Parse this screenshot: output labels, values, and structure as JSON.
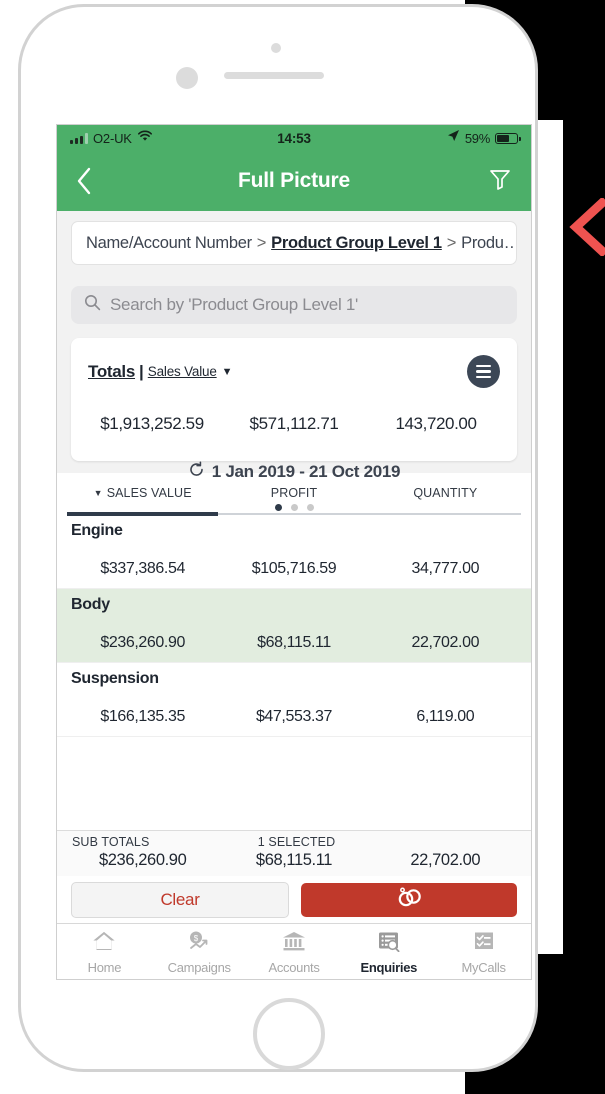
{
  "status_bar": {
    "carrier": "O2-UK",
    "time": "14:53",
    "battery_percent": "59%",
    "wifi_icon": "wifi-icon",
    "location_icon": "location-arrow-icon",
    "battery_icon": "battery-icon"
  },
  "nav": {
    "title": "Full Picture",
    "back_icon": "back-chevron-icon",
    "filter_icon": "filter-funnel-icon"
  },
  "breadcrumb": {
    "item1": "Name/Account Number",
    "sep1": ">",
    "item2": "Product Group Level 1",
    "sep2": ">",
    "item3": "Produ…"
  },
  "date_range": {
    "refresh_icon": "refresh-icon",
    "label": "1 Jan 2019 - 21 Oct 2019"
  },
  "search": {
    "placeholder": "Search by 'Product Group Level 1'",
    "icon": "search-icon"
  },
  "totals": {
    "label": "Totals",
    "pipe": "|",
    "metric": "Sales Value",
    "caret": "▼",
    "menu_icon": "hamburger-menu-icon",
    "values": [
      "$1,913,252.59",
      "$571,112.71",
      "143,720.00"
    ]
  },
  "table": {
    "columns": [
      {
        "label": "SALES VALUE",
        "sorted": true,
        "sort_caret": "▼"
      },
      {
        "label": "PROFIT",
        "sorted": false,
        "sort_caret": ""
      },
      {
        "label": "QUANTITY",
        "sorted": false,
        "sort_caret": ""
      }
    ],
    "page_dots": {
      "total": 3,
      "active_index": 0
    },
    "rows": [
      {
        "name": "Engine",
        "selected": false,
        "values": [
          "$337,386.54",
          "$105,716.59",
          "34,777.00"
        ]
      },
      {
        "name": "Body",
        "selected": true,
        "values": [
          "$236,260.90",
          "$68,115.11",
          "22,702.00"
        ]
      },
      {
        "name": "Suspension",
        "selected": false,
        "values": [
          "$166,135.35",
          "$47,553.37",
          "6,119.00"
        ]
      }
    ]
  },
  "sub_totals": {
    "label": "SUB TOTALS",
    "selected_label": "1 SELECTED",
    "values": [
      "$236,260.90",
      "$68,115.11",
      "22,702.00"
    ]
  },
  "actions": {
    "clear_label": "Clear",
    "link_icon": "linked-rings-icon"
  },
  "tab_bar": {
    "tabs": [
      {
        "label": "Home",
        "icon": "home-icon",
        "active": false
      },
      {
        "label": "Campaigns",
        "icon": "campaigns-dollar-chart-icon",
        "active": false
      },
      {
        "label": "Accounts",
        "icon": "bank-icon",
        "active": false
      },
      {
        "label": "Enquiries",
        "icon": "enquiries-search-list-icon",
        "active": true
      },
      {
        "label": "MyCalls",
        "icon": "checklist-icon",
        "active": false
      }
    ]
  },
  "annotation": {
    "chevron_icon": "left-chevron-annotation-icon",
    "color": "#ef5350"
  },
  "colors": {
    "header_green": "#4caf69",
    "selected_row_green": "#e2eddf",
    "accent_red": "#c0392b",
    "dark_slate": "#3c4756"
  }
}
